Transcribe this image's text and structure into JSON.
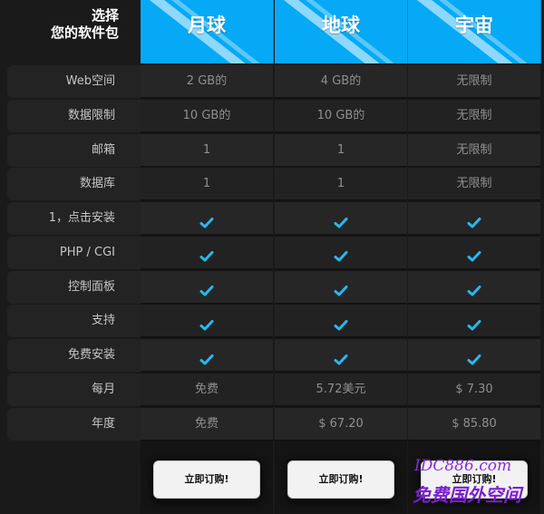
{
  "corner": {
    "line1": "选择",
    "line2": "您的软件包"
  },
  "plans": [
    {
      "title": "月球",
      "values": [
        "2 GB的",
        "10 GB的",
        "1",
        "1",
        "check",
        "check",
        "check",
        "check",
        "check",
        "免费",
        "免费"
      ],
      "button": "立即订购!"
    },
    {
      "title": "地球",
      "values": [
        "4 GB的",
        "10 GB的",
        "1",
        "1",
        "check",
        "check",
        "check",
        "check",
        "check",
        "5.72美元",
        "$ 67.20"
      ],
      "button": "立即订购!"
    },
    {
      "title": "宇宙",
      "values": [
        "无限制",
        "无限制",
        "无限制",
        "无限制",
        "check",
        "check",
        "check",
        "check",
        "check",
        "$ 7.30",
        "$ 85.80"
      ],
      "button": "立即订购!"
    }
  ],
  "features": [
    "Web空间",
    "数据限制",
    "邮箱",
    "数据库",
    "1，点击安装",
    "PHP / CGI",
    "控制面板",
    "支持",
    "免费安装",
    "每月",
    "年度"
  ],
  "watermark": {
    "line1": "IDC886.com",
    "line2": "免费国外空间"
  },
  "colors": {
    "header_blue": "#06a9f5",
    "check_blue": "#2ab7f0"
  },
  "icons": {
    "check": "checkmark-icon"
  }
}
